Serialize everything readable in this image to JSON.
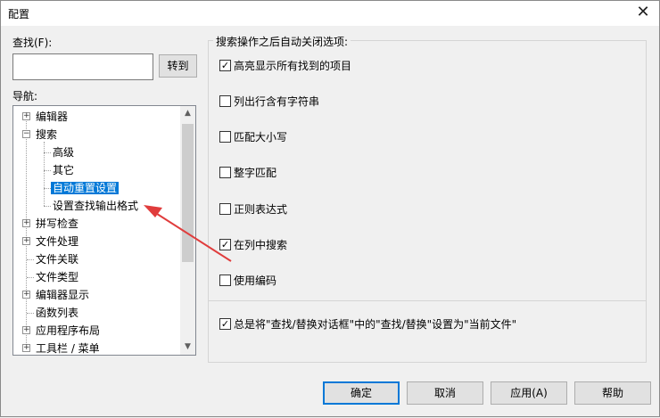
{
  "window": {
    "title": "配置",
    "close_symbol": "✕"
  },
  "find": {
    "label": "查找(F):",
    "value": "",
    "goto_button": "转到"
  },
  "nav": {
    "label": "导航:",
    "items": [
      {
        "label": "编辑器",
        "expander": "+"
      },
      {
        "label": "搜索",
        "expander": "−"
      },
      {
        "label": "高级"
      },
      {
        "label": "其它"
      },
      {
        "label": "自动重置设置",
        "selected": true
      },
      {
        "label": "设置查找输出格式"
      },
      {
        "label": "拼写检查",
        "expander": "+"
      },
      {
        "label": "文件处理",
        "expander": "+"
      },
      {
        "label": "文件关联"
      },
      {
        "label": "文件类型"
      },
      {
        "label": "编辑器显示",
        "expander": "+"
      },
      {
        "label": "函数列表"
      },
      {
        "label": "应用程序布局",
        "expander": "+"
      },
      {
        "label": "工具栏 / 菜单",
        "expander": "+"
      }
    ],
    "scroll_up": "▲",
    "scroll_down": "▼"
  },
  "group": {
    "title": "搜索操作之后自动关闭选项:",
    "options": [
      {
        "label": "高亮显示所有找到的项目",
        "checked": true,
        "mark": "✓"
      },
      {
        "label": "列出行含有字符串",
        "checked": false,
        "mark": ""
      },
      {
        "label": "匹配大小写",
        "checked": false,
        "mark": ""
      },
      {
        "label": "整字匹配",
        "checked": false,
        "mark": ""
      },
      {
        "label": "正则表达式",
        "checked": false,
        "mark": ""
      },
      {
        "label": "在列中搜索",
        "checked": true,
        "mark": "✓"
      },
      {
        "label": "使用编码",
        "checked": false,
        "mark": ""
      }
    ],
    "bottom_option": {
      "label": "总是将\"查找/替换对话框\"中的\"查找/替换\"设置为\"当前文件\"",
      "checked": true,
      "mark": "✓"
    }
  },
  "buttons": {
    "ok": "确定",
    "cancel": "取消",
    "apply": "应用(A)",
    "help": "帮助"
  },
  "annotation": {
    "color": "#e03c3c"
  }
}
